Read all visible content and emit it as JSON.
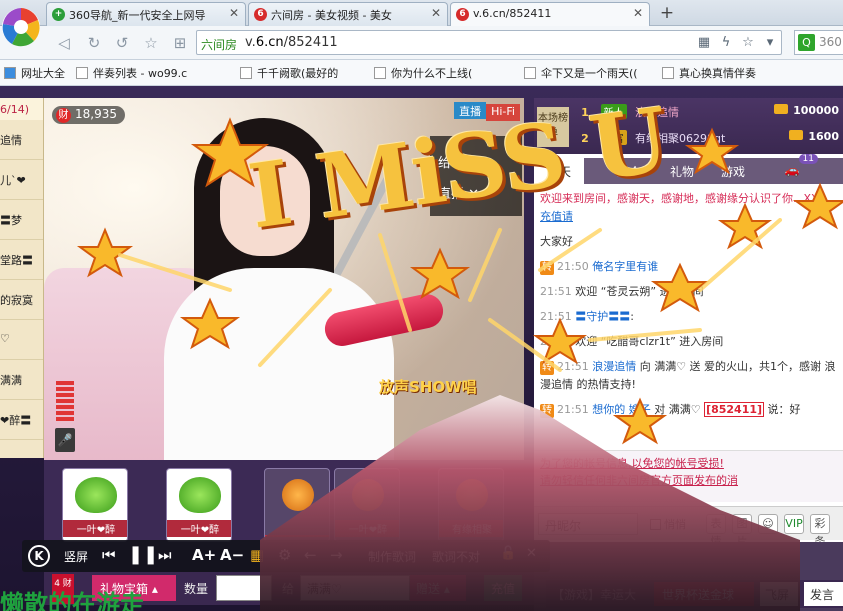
{
  "browser": {
    "tabs": [
      {
        "label": "360导航_新一代安全上网导",
        "active": false,
        "icon_color": "#2c9e3a"
      },
      {
        "label": "六间房 - 美女视频 - 美女",
        "active": false,
        "icon_color": "#d62b2b"
      },
      {
        "label": "v.6.cn/852411",
        "active": true,
        "icon_color": "#d62b2b"
      }
    ],
    "new_tab": "+",
    "address": {
      "site_label": "六间房",
      "url_prefix": "v.",
      "url_domain": "6.cn",
      "url_path": "/852411"
    },
    "search_placeholder": "360"
  },
  "bookmarks": [
    {
      "label": "网址大全"
    },
    {
      "label": "伴奏列表 - wo99.c"
    },
    {
      "label": "千千阙歌(最好的"
    },
    {
      "label": "你为什么不上线("
    },
    {
      "label": "伞下又是一个雨天(("
    },
    {
      "label": "真心换真情伴奏"
    }
  ],
  "left_column": {
    "header": "6/14)",
    "items": [
      "追情",
      "儿`❤",
      "〓梦",
      "堂路〓",
      "的寂寞",
      "♡",
      "满满",
      "❤醉〓"
    ]
  },
  "video": {
    "wealth_badge": "财",
    "wealth_count": "18,935",
    "live_label": "直播",
    "hifi_label": "Hi-Fi",
    "overlay_lines": [
      "给",
      "直播 ✕"
    ],
    "shout_text": "放声SHOW唱"
  },
  "rank": {
    "label": "本场榜单",
    "rows": [
      {
        "rank": "1",
        "level": "新人",
        "level_color": "#3a9c1a",
        "name": "浪漫追情",
        "coins": "100000"
      },
      {
        "rank": "2",
        "level": "一富",
        "level_color": "#d6a21a",
        "name": "有缘相聚06298gt",
        "coins": "1600"
      }
    ]
  },
  "chat_tabs": [
    {
      "label": "聊天",
      "active": true
    },
    {
      "label": "观众",
      "active": false
    },
    {
      "label": "礼物",
      "active": false
    },
    {
      "label": "游戏",
      "active": false
    },
    {
      "label": "座驾",
      "active": false,
      "badge": "11"
    }
  ],
  "chat": {
    "intro": "欢迎来到房间，感谢天，感谢地，感谢缘分认识了你...XX",
    "intro_link": "充值请",
    "messages": [
      {
        "tag": "",
        "time": "",
        "name": "",
        "text": "大家好"
      },
      {
        "tag": "转",
        "time": "21:50",
        "name": "俺名字里有谁",
        "text": ""
      },
      {
        "tag": "",
        "time": "21:51",
        "name": "",
        "text": "欢迎 “苍灵云朔” 进入房间"
      },
      {
        "tag": "",
        "time": "21:51",
        "name": "〓守护〓〓",
        "text": ":"
      },
      {
        "tag": "",
        "time": "21:51",
        "name": "",
        "text": "欢迎 “吃醋哥clzr1t” 进入房间"
      },
      {
        "tag": "转",
        "time": "21:51",
        "name": "浪漫追情",
        "text": "向 满满♡ 送 爱的火山，共1个，感谢 浪漫追情 的热情支持!"
      },
      {
        "tag": "转",
        "time": "21:51",
        "name": "想你的 嫂子",
        "text": "对 满满♡",
        "room": "[852411]",
        "tail": "说：好"
      }
    ]
  },
  "notices": [
    "为了您的帐号信息,以免您的帐号受损!",
    "请勿轻信任何非六间房官方页面发布的消"
  ],
  "send_row": {
    "nickname": "丹昵尔",
    "quiet_label": "悄悄",
    "tools": [
      "表情",
      "图片",
      "☺",
      "VIP",
      "彩条"
    ]
  },
  "gifts": [
    {
      "name": "一叶❤醉",
      "kind": "alien"
    },
    {
      "name": "一叶❤醉",
      "kind": "alien"
    },
    {
      "name": "",
      "kind": "fire"
    },
    {
      "name": "一叶❤醉",
      "kind": "dark"
    },
    {
      "name": "有缘相聚",
      "kind": "dark"
    }
  ],
  "music_bar": {
    "logo": "K",
    "mode_label": "竖屏",
    "make_lyrics": "制作歌词",
    "lyrics_wrong": "歌词不对"
  },
  "bottom_bar": {
    "fortune": "4 财",
    "gift_box": "礼物宝箱 ▴",
    "qty_label": "数量",
    "to_label": "给",
    "target": "满满♡",
    "send_gift": "赠送 ▴",
    "recharge": "充值"
  },
  "game_bar": {
    "text": "【游戏】幸运大",
    "worldcup": "世界杯送金球",
    "fly_screen": "飞屏",
    "speak": "发言"
  },
  "marquee": "懒散的在游走",
  "effect_text": "I MiSS U"
}
